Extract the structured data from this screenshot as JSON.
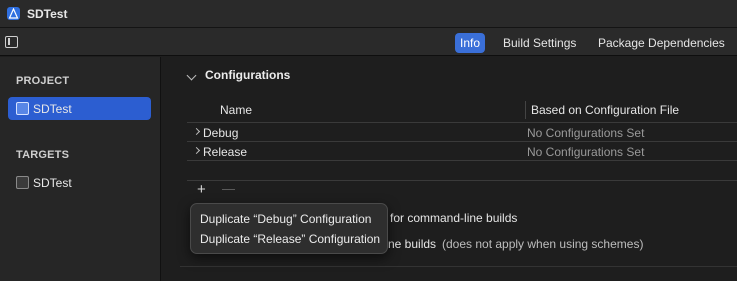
{
  "window": {
    "title": "SDTest"
  },
  "tabs": [
    {
      "label": "Info",
      "active": true
    },
    {
      "label": "Build Settings",
      "active": false
    },
    {
      "label": "Package Dependencies",
      "active": false
    }
  ],
  "sidebar": {
    "project_header": "PROJECT",
    "project_item": "SDTest",
    "targets_header": "TARGETS",
    "target_item": "SDTest"
  },
  "configurations": {
    "section_title": "Configurations",
    "columns": [
      "Name",
      "Based on Configuration File"
    ],
    "rows": [
      {
        "name": "Debug",
        "file": "No Configurations Set"
      },
      {
        "name": "Release",
        "file": "No Configurations Set"
      }
    ],
    "add_symbol": "+",
    "cmdline_text_fragment": "for command-line builds",
    "builds_text_fragment": "ne builds",
    "note_text": "(does not apply when using schemes)"
  },
  "popup_menu": {
    "items": [
      "Duplicate “Debug” Configuration",
      "Duplicate “Release” Configuration"
    ]
  },
  "colors": {
    "accent": "#2c5ed1",
    "tab_active": "#3a6fd8"
  }
}
